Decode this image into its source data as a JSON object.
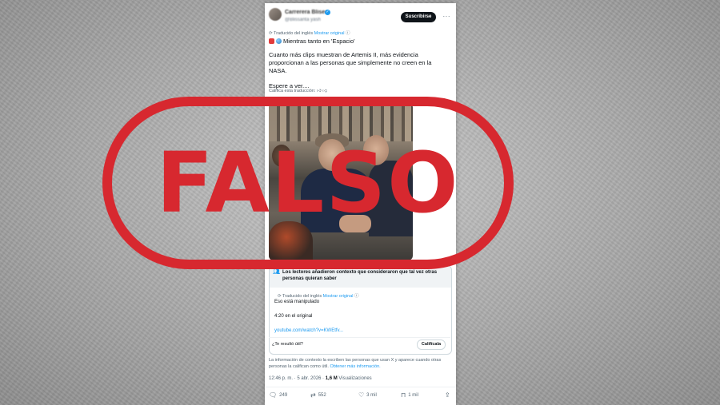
{
  "tweet": {
    "subscribe_label": "Suscribirse",
    "more_label": "···",
    "translated_prefix": "Traducido del inglés",
    "show_original": "Mostrar original",
    "headline": "Mientras tanto en 'Espacio'",
    "paragraphs": [
      "Cuanto más clips muestran de Artemis II, más evidencia proporcionan a las personas que simplemente no creen en la NASA.",
      "Espere a ver...."
    ],
    "rate_translation": "Califica esta traducción:",
    "community_note": {
      "header": "Los lectores añadieron contexto que consideraron que tal vez otras personas quieran saber",
      "translated_prefix": "Traducido del inglés",
      "show_original": "Mostrar original",
      "line1": "Eso está manipulado",
      "line2": "4:20 en el original",
      "link": "youtube.com/watch?v=KWEtfv...",
      "helpful_question": "¿Te resultó útil?",
      "rate_button": "Califícala"
    },
    "footnote": "La información de contexto la escriben las personas que usan X y aparece cuando otras personas la califican como útil.",
    "footnote_link": "Obtener más información.",
    "time": "12:46 p. m. · 5 abr. 2026 ·",
    "views_count": "1,6 M",
    "views_label": "Visualizaciones",
    "actions": {
      "replies": "249",
      "reposts": "552",
      "likes": "3 mil",
      "bookmarks": "1 mil"
    }
  },
  "overlay": {
    "stamp_text": "FALSO",
    "stamp_color": "#d7282f"
  },
  "colors": {
    "link": "#1d9bf0",
    "text": "#0f1419",
    "secondary": "#536471"
  }
}
